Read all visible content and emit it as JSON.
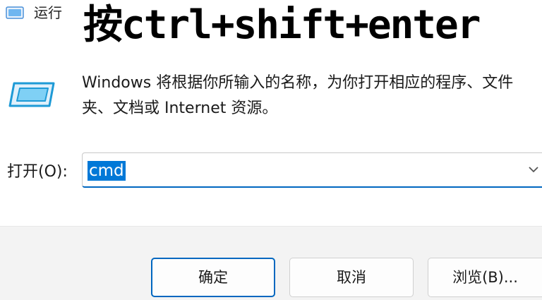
{
  "window": {
    "title": "运行",
    "app_icon": "run-dialog-icon"
  },
  "overlay": {
    "caption": "按ctrl+shift+enter"
  },
  "body": {
    "icon": "run-program-icon",
    "description": "Windows 将根据你所输入的名称，为你打开相应的程序、文件夹、文档或 Internet 资源。",
    "open_label": "打开(O):",
    "input_value": "cmd",
    "dropdown_icon": "chevron-down-icon"
  },
  "buttons": {
    "ok": "确定",
    "cancel": "取消",
    "browse": "浏览(B)..."
  },
  "colors": {
    "accent": "#0067c0",
    "selection": "#0078d7",
    "footer_bg": "#f3f3f3"
  }
}
